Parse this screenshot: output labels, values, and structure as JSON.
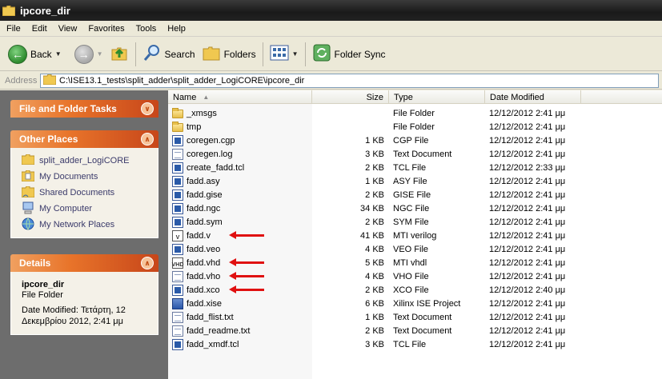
{
  "window": {
    "title": "ipcore_dir"
  },
  "menu": [
    "File",
    "Edit",
    "View",
    "Favorites",
    "Tools",
    "Help"
  ],
  "toolbar": {
    "back": "Back",
    "search": "Search",
    "folders": "Folders",
    "folder_sync": "Folder Sync"
  },
  "address": {
    "label": "Address",
    "path": "C:\\ISE13.1_tests\\split_adder\\split_adder_LogiCORE\\ipcore_dir"
  },
  "tasks": {
    "file_folder_tasks": "File and Folder Tasks",
    "other_places": {
      "title": "Other Places",
      "items": [
        "split_adder_LogiCORE",
        "My Documents",
        "Shared Documents",
        "My Computer",
        "My Network Places"
      ]
    },
    "details": {
      "title": "Details",
      "name": "ipcore_dir",
      "type": "File Folder",
      "line1": "Date Modified: Τετάρτη, 12",
      "line2": "Δεκεμβρίου 2012, 2:41 μμ"
    }
  },
  "columns": {
    "name": "Name",
    "size": "Size",
    "type": "Type",
    "date": "Date Modified"
  },
  "files": [
    {
      "name": "_xmsgs",
      "size": "",
      "type": "File Folder",
      "date": "12/12/2012 2:41 μμ",
      "icon": "folder"
    },
    {
      "name": "tmp",
      "size": "",
      "type": "File Folder",
      "date": "12/12/2012 2:41 μμ",
      "icon": "folder"
    },
    {
      "name": "coregen.cgp",
      "size": "1 KB",
      "type": "CGP File",
      "date": "12/12/2012 2:41 μμ",
      "icon": "app"
    },
    {
      "name": "coregen.log",
      "size": "3 KB",
      "type": "Text Document",
      "date": "12/12/2012 2:41 μμ",
      "icon": "doc"
    },
    {
      "name": "create_fadd.tcl",
      "size": "2 KB",
      "type": "TCL File",
      "date": "12/12/2012 2:33 μμ",
      "icon": "app"
    },
    {
      "name": "fadd.asy",
      "size": "1 KB",
      "type": "ASY File",
      "date": "12/12/2012 2:41 μμ",
      "icon": "app"
    },
    {
      "name": "fadd.gise",
      "size": "2 KB",
      "type": "GISE File",
      "date": "12/12/2012 2:41 μμ",
      "icon": "app"
    },
    {
      "name": "fadd.ngc",
      "size": "34 KB",
      "type": "NGC File",
      "date": "12/12/2012 2:41 μμ",
      "icon": "app"
    },
    {
      "name": "fadd.sym",
      "size": "2 KB",
      "type": "SYM File",
      "date": "12/12/2012 2:41 μμ",
      "icon": "app"
    },
    {
      "name": "fadd.v",
      "size": "41 KB",
      "type": "MTI verilog",
      "date": "12/12/2012 2:41 μμ",
      "icon": "vlog",
      "badge": "V"
    },
    {
      "name": "fadd.veo",
      "size": "4 KB",
      "type": "VEO File",
      "date": "12/12/2012 2:41 μμ",
      "icon": "app"
    },
    {
      "name": "fadd.vhd",
      "size": "5 KB",
      "type": "MTI vhdl",
      "date": "12/12/2012 2:41 μμ",
      "icon": "vlog",
      "badge": "VHD"
    },
    {
      "name": "fadd.vho",
      "size": "4 KB",
      "type": "VHO File",
      "date": "12/12/2012 2:41 μμ",
      "icon": "doc"
    },
    {
      "name": "fadd.xco",
      "size": "2 KB",
      "type": "XCO File",
      "date": "12/12/2012 2:40 μμ",
      "icon": "app"
    },
    {
      "name": "fadd.xise",
      "size": "6 KB",
      "type": "Xilinx ISE Project",
      "date": "12/12/2012 2:41 μμ",
      "icon": "xise"
    },
    {
      "name": "fadd_flist.txt",
      "size": "1 KB",
      "type": "Text Document",
      "date": "12/12/2012 2:41 μμ",
      "icon": "doc"
    },
    {
      "name": "fadd_readme.txt",
      "size": "2 KB",
      "type": "Text Document",
      "date": "12/12/2012 2:41 μμ",
      "icon": "doc"
    },
    {
      "name": "fadd_xmdf.tcl",
      "size": "3 KB",
      "type": "TCL File",
      "date": "12/12/2012 2:41 μμ",
      "icon": "app"
    }
  ],
  "highlighted_rows": [
    9,
    11,
    12,
    13
  ],
  "colors": {
    "highlight_arrow": "#e01010",
    "task_header": "#e8742a"
  }
}
